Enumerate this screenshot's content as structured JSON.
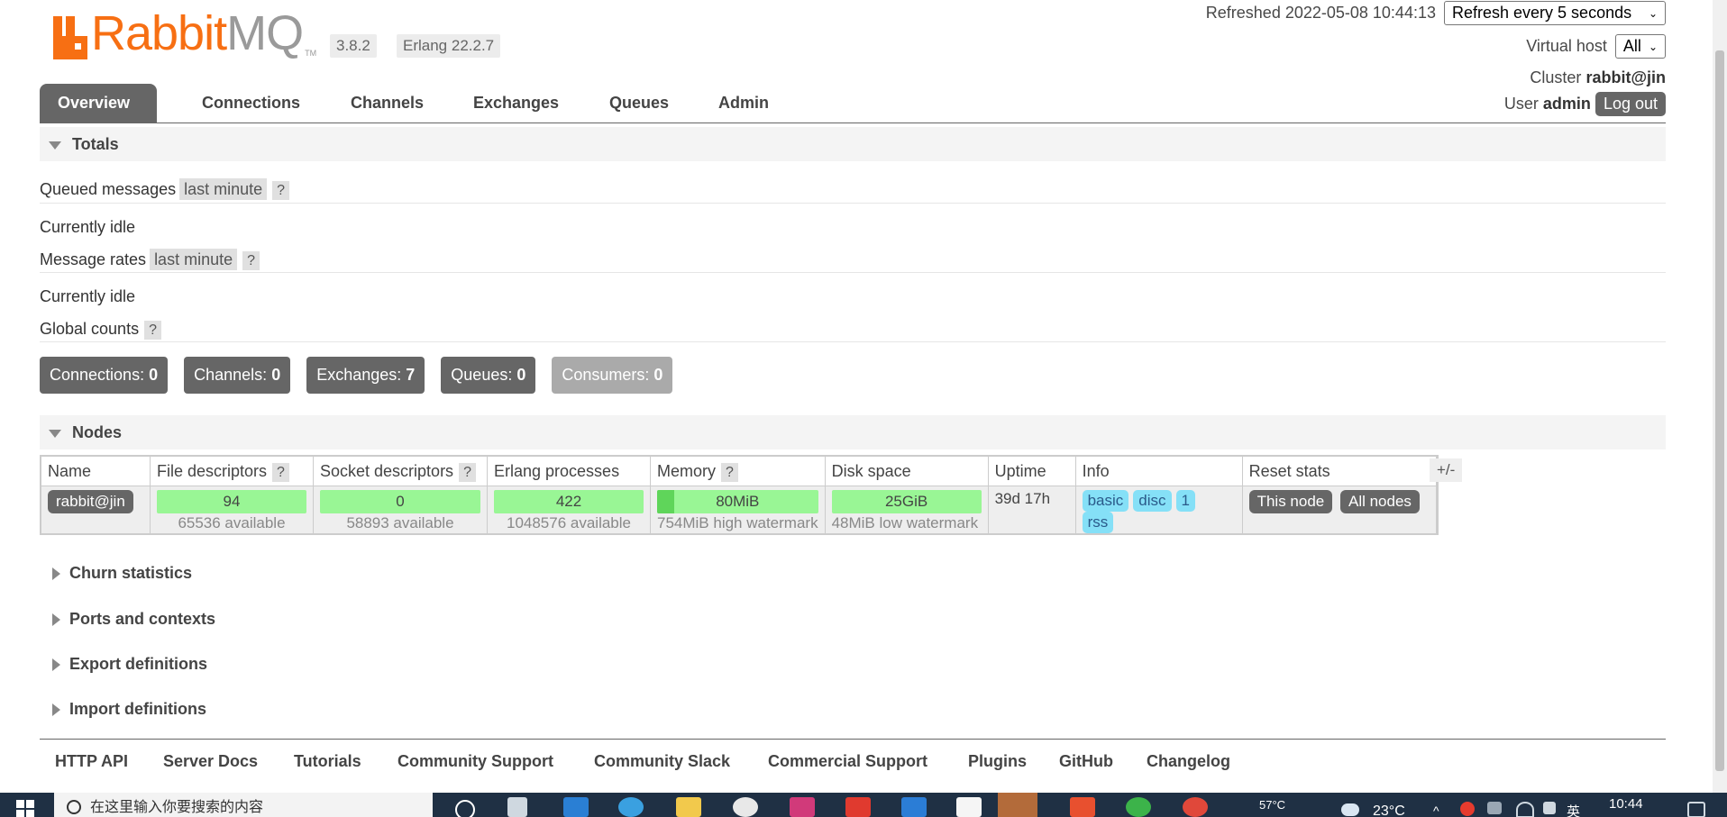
{
  "header": {
    "logo_text_a": "Rabbit",
    "logo_text_b": "MQ",
    "logo_tm": "TM",
    "version": "3.8.2",
    "erlang": "Erlang 22.2.7",
    "refreshed_label": "Refreshed 2022-05-08 10:44:13",
    "refresh_select": "Refresh every 5 seconds",
    "vhost_label": "Virtual host",
    "vhost_value": "All",
    "cluster_label": "Cluster",
    "cluster_value": "rabbit@jin",
    "user_label": "User",
    "user_value": "admin",
    "logout": "Log out"
  },
  "tabs": [
    "Overview",
    "Connections",
    "Channels",
    "Exchanges",
    "Queues",
    "Admin"
  ],
  "totals": {
    "title": "Totals",
    "queued_label": "Queued messages",
    "queued_range": "last minute",
    "help": "?",
    "idle1": "Currently idle",
    "rates_label": "Message rates",
    "rates_range": "last minute",
    "idle2": "Currently idle",
    "global_label": "Global counts"
  },
  "counts": [
    {
      "label": "Connections:",
      "value": "0"
    },
    {
      "label": "Channels:",
      "value": "0"
    },
    {
      "label": "Exchanges:",
      "value": "7"
    },
    {
      "label": "Queues:",
      "value": "0"
    },
    {
      "label": "Consumers:",
      "value": "0"
    }
  ],
  "nodes": {
    "title": "Nodes",
    "headers": [
      "Name",
      "File descriptors",
      "Socket descriptors",
      "Erlang processes",
      "Memory",
      "Disk space",
      "Uptime",
      "Info",
      "Reset stats"
    ],
    "row": {
      "name": "rabbit@jin",
      "fd": "94",
      "fd_avail": "65536 available",
      "sd": "0",
      "sd_avail": "58893 available",
      "ep": "422",
      "ep_avail": "1048576 available",
      "mem": "80MiB",
      "mem_wm": "754MiB high watermark",
      "disk": "25GiB",
      "disk_wm": "48MiB low watermark",
      "uptime": "39d 17h",
      "info": [
        "basic",
        "disc",
        "1",
        "rss"
      ],
      "reset_this": "This node",
      "reset_all": "All nodes"
    },
    "plusminus": "+/-",
    "memory_fraction": 0.106
  },
  "sections": [
    "Churn statistics",
    "Ports and contexts",
    "Export definitions",
    "Import definitions"
  ],
  "footer": [
    "HTTP API",
    "Server Docs",
    "Tutorials",
    "Community Support",
    "Community Slack",
    "Commercial Support",
    "Plugins",
    "GitHub",
    "Changelog"
  ],
  "taskbar": {
    "search_placeholder": "在这里输入你要搜索的内容",
    "temp_cpu": "57°C",
    "weather": "23°C",
    "ime": "英",
    "time": "10:44"
  },
  "colors": {
    "accent": "#666666",
    "green": "#99f695",
    "orange": "#f76f13",
    "badge": "#85e0f7"
  }
}
